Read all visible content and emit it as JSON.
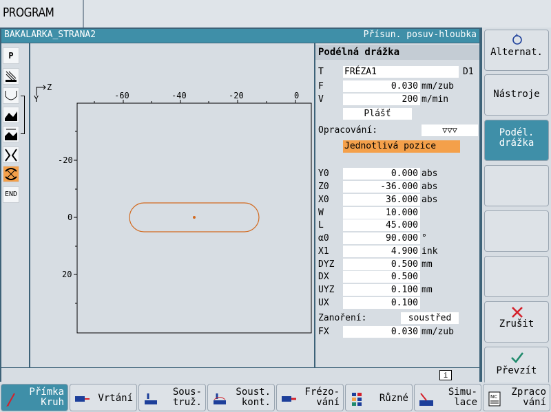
{
  "header": {
    "area": "PROGRAM"
  },
  "title_bar": {
    "program_name": "BAKALARKA_STRANA2",
    "status": "Přísun. posuv-hloubka"
  },
  "left_icons": [
    "P",
    "END"
  ],
  "graphics": {
    "axis_h": "Z",
    "axis_v": "Y",
    "top_ticks": [
      "-60",
      "-40",
      "-20",
      "0"
    ],
    "left_ticks": [
      "-20",
      "0",
      "20"
    ]
  },
  "params": {
    "title": "Podélná drážka",
    "tool": {
      "label": "T",
      "value": "FRÉZA1",
      "d": "D1"
    },
    "feed": {
      "label": "F",
      "value": "0.030",
      "unit": "mm/zub"
    },
    "speed": {
      "label": "V",
      "value": "200",
      "unit": "m/min"
    },
    "surface": "Plášť",
    "machining": {
      "label": "Opracování:",
      "value": "▽▽▽"
    },
    "mode": "Jednotlivá pozice",
    "rows": [
      {
        "label": "Y0",
        "value": "0.000",
        "unit": "abs"
      },
      {
        "label": "Z0",
        "value": "-36.000",
        "unit": "abs"
      },
      {
        "label": "X0",
        "value": "36.000",
        "unit": "abs"
      },
      {
        "label": "W",
        "value": "10.000",
        "unit": ""
      },
      {
        "label": "L",
        "value": "45.000",
        "unit": ""
      },
      {
        "label": "α0",
        "value": "90.000",
        "unit": "°"
      },
      {
        "label": "X1",
        "value": "4.900",
        "unit": "ink"
      },
      {
        "label": "DYZ",
        "value": "0.500",
        "unit": "mm"
      },
      {
        "label": "DX",
        "value": "0.500",
        "unit": ""
      },
      {
        "label": "UYZ",
        "value": "0.100",
        "unit": "mm"
      },
      {
        "label": "UX",
        "value": "0.100",
        "unit": ""
      }
    ],
    "plunge": {
      "label": "Zanoření:",
      "value": "soustřed"
    },
    "fx": {
      "label": "FX",
      "value": "0.030",
      "unit": "mm/zub"
    }
  },
  "status_bar": {
    "info": "i"
  },
  "right_softkeys": {
    "alternat": "Alternat.",
    "nastroje": "Nástroje",
    "podel_1": "Podél.",
    "podel_2": "drážka",
    "zrusit": "Zrušit",
    "prevzit": "Převzít"
  },
  "bottom_softkeys": [
    {
      "l1": "Přímka",
      "l2": "Kruh"
    },
    {
      "l1": "Vrtání",
      "l2": ""
    },
    {
      "l1": "Sous-",
      "l2": "truž."
    },
    {
      "l1": "Soust.",
      "l2": "kont."
    },
    {
      "l1": "Frézo-",
      "l2": "vání"
    },
    {
      "l1": "Různé",
      "l2": ""
    },
    {
      "l1": "Simu-",
      "l2": "lace"
    },
    {
      "l1": "Zpraco",
      "l2": "vání"
    }
  ],
  "colors": {
    "accent": "#3f8fa8",
    "highlight": "#f4a04a",
    "contour": "#d2691e"
  }
}
